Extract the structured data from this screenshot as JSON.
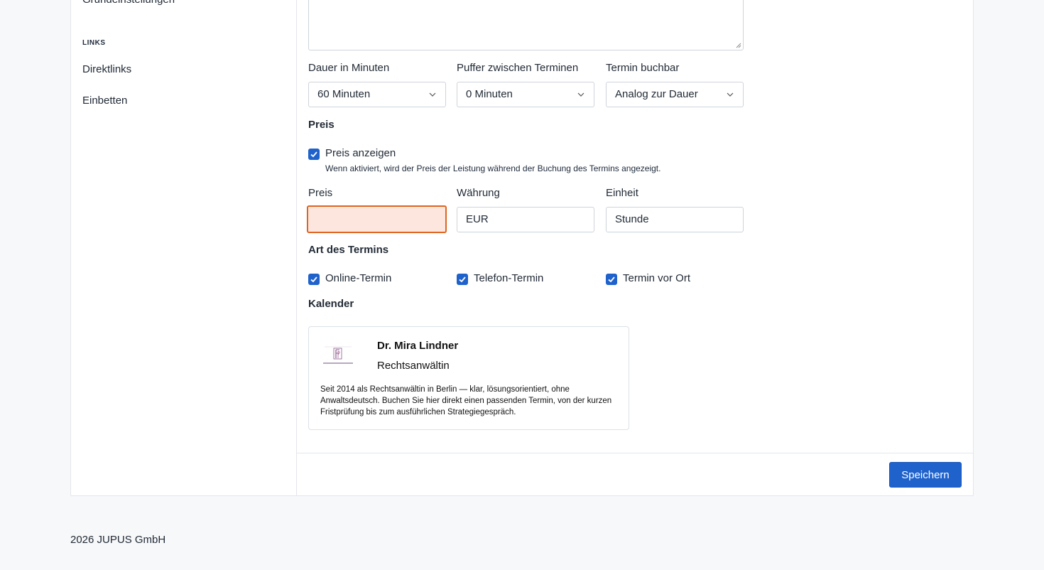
{
  "sidebar": {
    "cut_item": "Grundeinstellungen",
    "section_label": "LINKS",
    "items": [
      {
        "label": "Direktlinks"
      },
      {
        "label": "Einbetten"
      }
    ]
  },
  "form": {
    "duration": {
      "label": "Dauer in Minuten",
      "value": "60 Minuten"
    },
    "buffer": {
      "label": "Puffer zwischen Terminen",
      "value": "0 Minuten"
    },
    "bookable": {
      "label": "Termin buchbar",
      "value": "Analog zur Dauer"
    },
    "price_section": "Preis",
    "show_price": {
      "label": "Preis anzeigen",
      "checked": true,
      "help": "Wenn aktiviert, wird der Preis der Leistung während der Buchung des Termins angezeigt."
    },
    "price": {
      "label": "Preis",
      "value": ""
    },
    "currency": {
      "label": "Währung",
      "value": "EUR"
    },
    "unit": {
      "label": "Einheit",
      "value": "Stunde"
    },
    "type_section": "Art des Termins",
    "types": [
      {
        "label": "Online-Termin",
        "checked": true
      },
      {
        "label": "Telefon-Termin",
        "checked": true
      },
      {
        "label": "Termin vor Ort",
        "checked": true
      }
    ],
    "calendar_section": "Kalender"
  },
  "calendar_card": {
    "name": "Dr. Mira Lindner",
    "role": "Rechtsanwältin",
    "description": "Seit 2014 als Rechtsanwältin in Berlin — klar, lösungsorientiert, ohne Anwaltsdeutsch. Buchen Sie hier direkt einen passenden Termin, von der kurzen Fristprüfung bis zum ausführlichen Strategiegespräch."
  },
  "actions": {
    "save_label": "Speichern"
  },
  "footer": {
    "text": "2026 JUPUS GmbH"
  },
  "colors": {
    "accent": "#1f62cc",
    "error_bg": "#fde6dd",
    "error_border": "#e0641f"
  }
}
